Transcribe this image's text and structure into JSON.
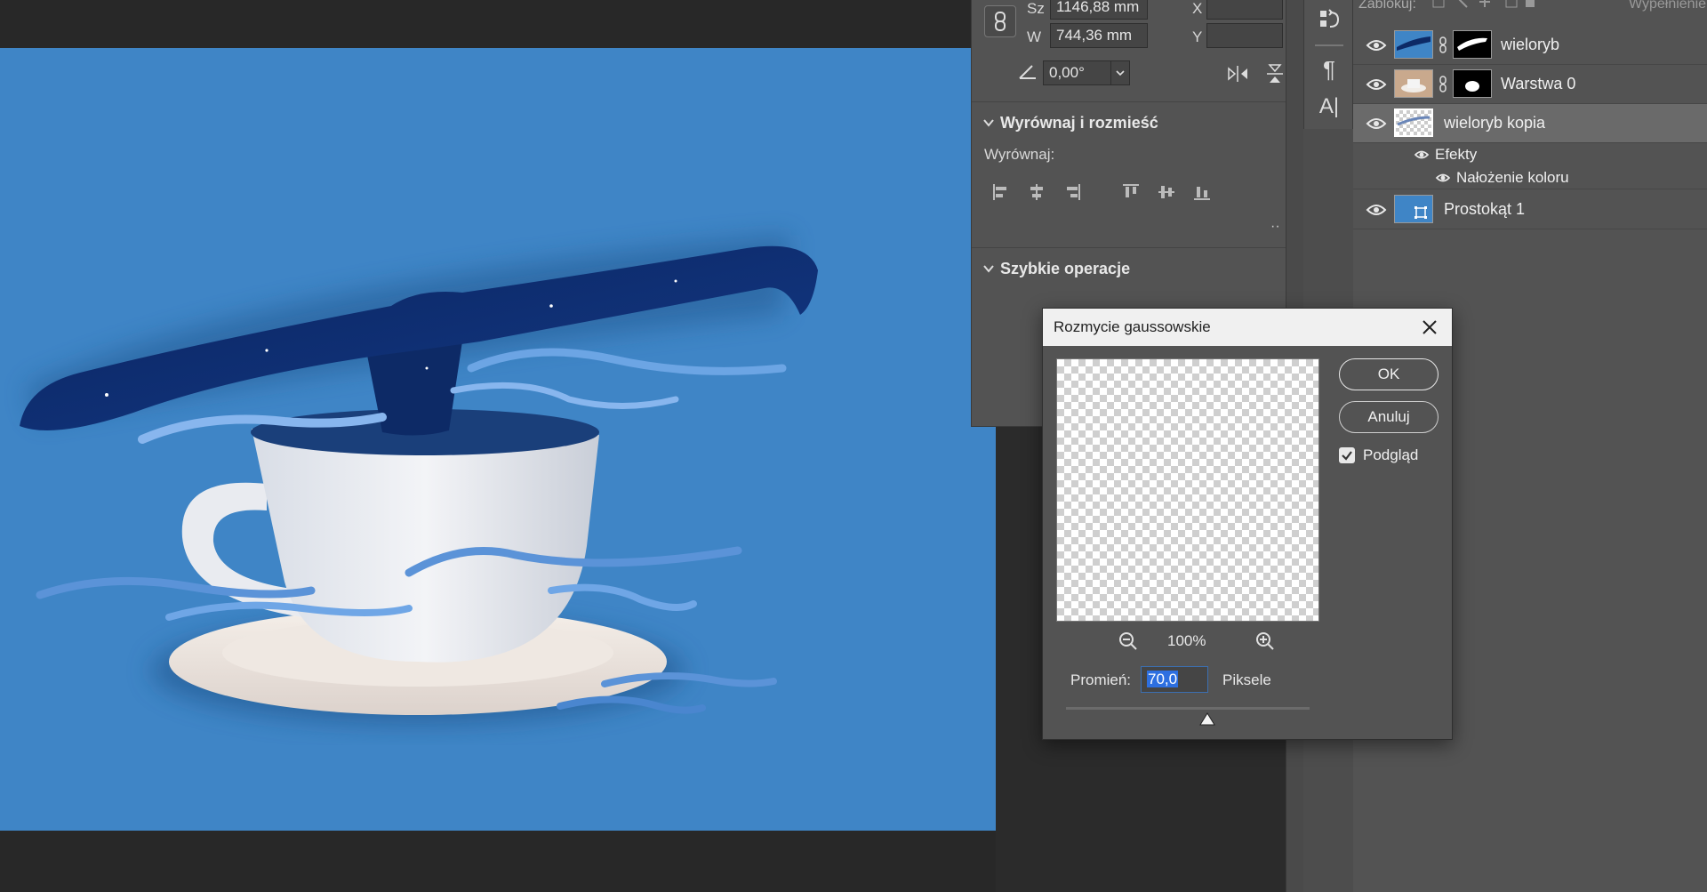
{
  "properties": {
    "width_label": "Sz",
    "width_value": "1146,88 mm",
    "height_label": "W",
    "height_value": "744,36 mm",
    "x_label": "X",
    "y_label": "Y",
    "angle_value": "0,00°",
    "align_section_title": "Wyrównaj i rozmieść",
    "align_label": "Wyrównaj:",
    "quick_actions_title": "Szybkie operacje"
  },
  "layers_panel": {
    "lock_label": "Zablokuj:",
    "fill_label": "Wypełnienie",
    "layers": [
      {
        "name": "wieloryb",
        "selected": false
      },
      {
        "name": "Warstwa 0",
        "selected": false
      },
      {
        "name": "wieloryb kopia",
        "selected": true
      },
      {
        "name": "Efekty",
        "sub": true
      },
      {
        "name": "Nałożenie koloru",
        "sub": true
      },
      {
        "name": "Prostokąt 1",
        "selected": false
      }
    ]
  },
  "dialog": {
    "title": "Rozmycie gaussowskie",
    "ok_label": "OK",
    "cancel_label": "Anuluj",
    "preview_label": "Podgląd",
    "preview_checked": true,
    "zoom_value": "100%",
    "radius_label": "Promień:",
    "radius_value": "70,0",
    "units_label": "Piksele",
    "slider_value_fraction": 0.58
  },
  "colors": {
    "canvas_bg": "#3f85c6",
    "panel_bg": "#535353",
    "whale": "#0d2a6b"
  }
}
